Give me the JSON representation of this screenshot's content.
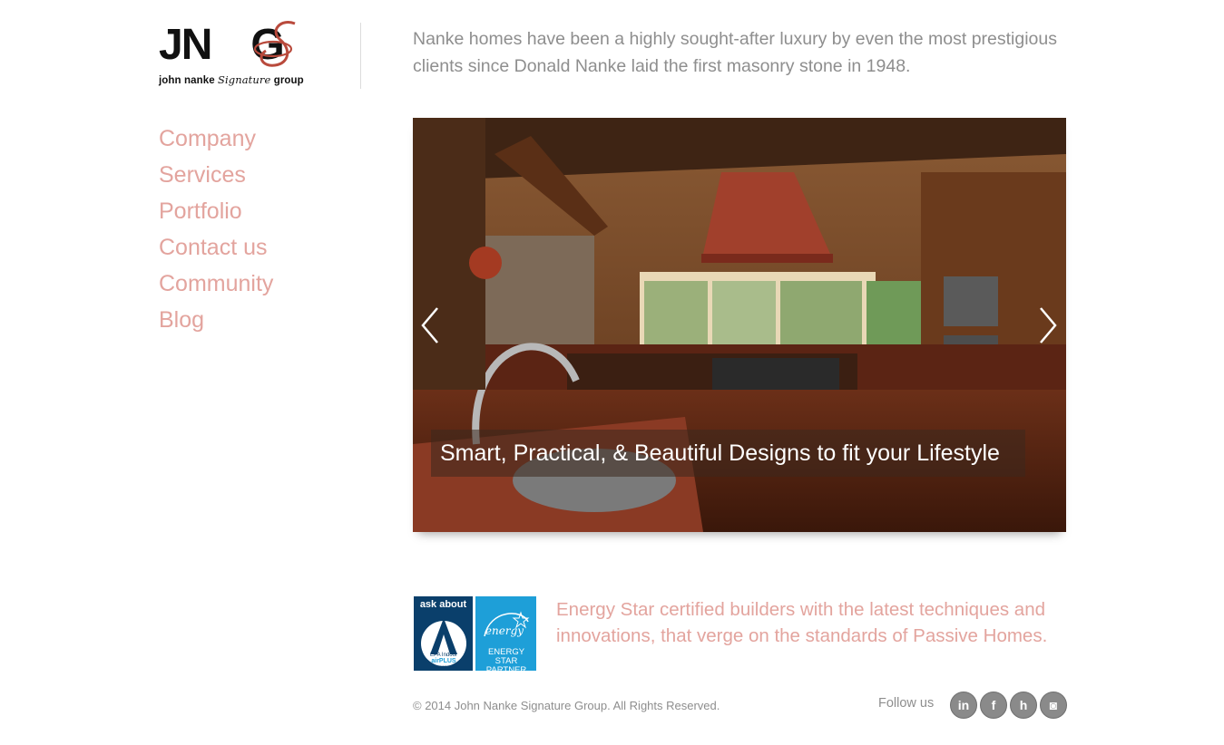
{
  "logo": {
    "mark_left": "JN",
    "mark_right": "G",
    "subtitle_pre": "john nanke ",
    "subtitle_script": "Signature",
    "subtitle_post": " group"
  },
  "intro_text": "Nanke homes have been a highly sought-after luxury by even the most prestigious clients since Donald Nanke laid the first masonry stone in 1948.",
  "nav": {
    "items": [
      {
        "label": "Company"
      },
      {
        "label": "Services"
      },
      {
        "label": "Portfolio"
      },
      {
        "label": "Contact us"
      },
      {
        "label": "Community"
      },
      {
        "label": "Blog"
      }
    ]
  },
  "slider": {
    "caption": "Smart, Practical, & Beautiful Designs to fit your Lifestyle",
    "prev_icon": "chevron-left-icon",
    "next_icon": "chevron-right-icon"
  },
  "badges": {
    "airplus_top": "ask about",
    "airplus_line1": "EPA Indoor",
    "airplus_line2": "airPLUS",
    "airplus_line3": "QUALIFIED HOME",
    "energy_script": "energy",
    "energy_line1": "ENERGY STAR",
    "energy_line2": "PARTNER"
  },
  "energy_text": "Energy Star certified builders with the latest techniques and innovations, that verge on the standards of Passive Homes.",
  "footer": {
    "copyright": "© 2014 John Nanke Signature Group. All Rights Reserved.",
    "follow_label": "Follow us",
    "social": [
      {
        "icon": "linkedin-icon",
        "glyph": "in"
      },
      {
        "icon": "facebook-icon",
        "glyph": "f"
      },
      {
        "icon": "houzz-icon",
        "glyph": "h"
      },
      {
        "icon": "instagram-icon",
        "glyph": "◙"
      }
    ]
  },
  "colors": {
    "accent": "#e3a49e",
    "text_muted": "#8e8e8e"
  }
}
